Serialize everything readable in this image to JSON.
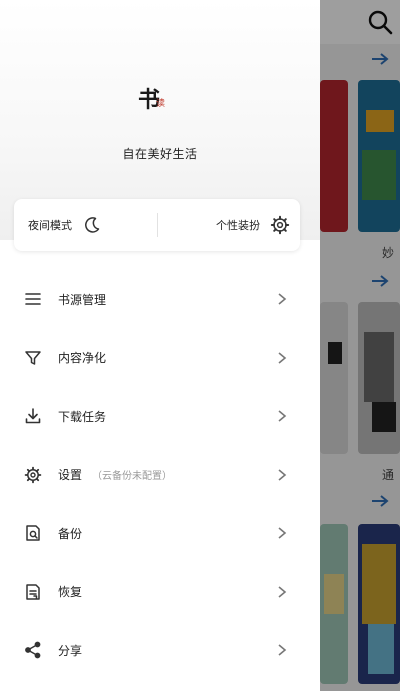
{
  "drawer": {
    "logo": {
      "main": "书",
      "seal": "读"
    },
    "slogan": "自在美好生活",
    "night_mode_label": "夜间模式",
    "theme_label": "个性装扮"
  },
  "menu": {
    "items": [
      {
        "label": "书源管理",
        "icon": "list-icon"
      },
      {
        "label": "内容净化",
        "icon": "filter-icon"
      },
      {
        "label": "下载任务",
        "icon": "download-icon"
      },
      {
        "label": "设置",
        "note": "（云备份未配置）",
        "icon": "gear-icon"
      },
      {
        "label": "备份",
        "icon": "backup-icon"
      },
      {
        "label": "恢复",
        "icon": "restore-icon"
      },
      {
        "label": "分享",
        "icon": "share-icon"
      }
    ]
  },
  "background": {
    "book_label_1": "妙",
    "book_label_2": "通"
  },
  "colors": {
    "drawer_bg": "#ffffff",
    "text_primary": "#222222",
    "text_muted": "#999999",
    "arrow_blue": "#2f6fb5"
  }
}
